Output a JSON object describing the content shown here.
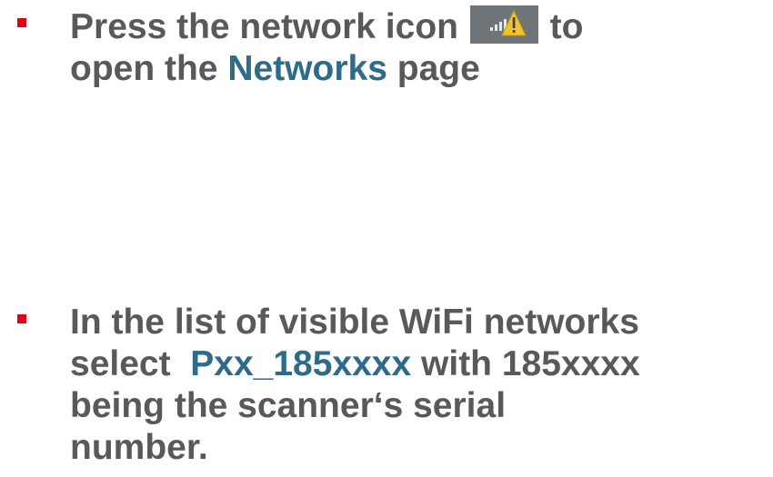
{
  "bullets": [
    {
      "line1_before_icon": "Press the network icon ",
      "line1_after_icon": " to",
      "line2_before_link": "open the ",
      "line2_link": "Networks",
      "line2_after_link": " page",
      "icon": "network-warning-icon"
    },
    {
      "line1": "In the list of visible WiFi networks",
      "line2_before_link": "select  ",
      "line2_link": "Pxx_185xxxx",
      "line2_after_link": " with 185xxxx",
      "line3": "being the scanner‘s serial",
      "line4": "number."
    }
  ],
  "colors": {
    "text": "#595959",
    "highlight": "#2e6b8a",
    "bullet": "#e2001a",
    "icon_background": "#6f7479",
    "icon_warning": "#f2c230"
  }
}
